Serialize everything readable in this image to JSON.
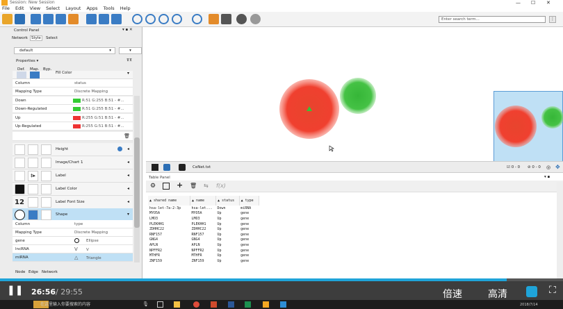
{
  "window": {
    "title": "Session: New Session"
  },
  "menu": [
    "File",
    "Edit",
    "View",
    "Select",
    "Layout",
    "Apps",
    "Tools",
    "Help"
  ],
  "search": {
    "placeholder": "Enter search term..."
  },
  "control_panel": {
    "title": "Control Panel",
    "tabs": [
      "Network",
      "Style",
      "Select"
    ],
    "style_dropdown": "default",
    "properties_label": "Properties",
    "columns": [
      "Def.",
      "Map.",
      "Byp."
    ],
    "fill_color_label": "Fill Color",
    "fill_color_mapping": [
      {
        "k": "Column",
        "v": "status"
      },
      {
        "k": "Mapping Type",
        "v": "Discrete Mapping"
      },
      {
        "k": "Down",
        "v": "R:51 G:255 B:51 - #...",
        "color": "#33cc33"
      },
      {
        "k": "Down-Regulated",
        "v": "R:51 G:255 B:51 - #...",
        "color": "#33cc33"
      },
      {
        "k": "Up",
        "v": "R:255 G:51 B:51 - #...",
        "color": "#ee3333"
      },
      {
        "k": "Up-Regulated",
        "v": "R:255 G:51 B:51 - #...",
        "color": "#ee3333"
      }
    ],
    "props": [
      "Height",
      "Image/Chart 1",
      "Label",
      "Label Color",
      "Label Font Size",
      "Shape"
    ],
    "label_font_size": "12",
    "shape_mapping": [
      {
        "k": "Column",
        "v": "type"
      },
      {
        "k": "Mapping Type",
        "v": "Discrete Mapping"
      },
      {
        "k": "gene",
        "v": "Ellipse"
      },
      {
        "k": "lncRNA",
        "v": "V"
      },
      {
        "k": "miRNA",
        "v": "Triangle"
      }
    ],
    "bottom_tabs": [
      "Node",
      "Edge",
      "Network"
    ]
  },
  "network": {
    "file": "CeNet.txt",
    "status_selected_nodes": "0 - 0",
    "status_selected_edges": "0 - 0"
  },
  "table_panel": {
    "title": "Table Panel",
    "formula": "f(x)",
    "headers": [
      "shared name",
      "name",
      "status",
      "type"
    ],
    "rows": [
      [
        "hsa-let-7a-2-3p",
        "hsa-let...",
        "Down",
        "miRNA"
      ],
      [
        "MYO5A",
        "MYO5A",
        "Up",
        "gene"
      ],
      [
        "LMO3",
        "LMO3",
        "Up",
        "gene"
      ],
      [
        "PLEKHH1",
        "PLEKHH1",
        "Up",
        "gene"
      ],
      [
        "ZDHHC22",
        "ZDHHC22",
        "Up",
        "gene"
      ],
      [
        "RNF157",
        "RNF157",
        "Up",
        "gene"
      ],
      [
        "GNG4",
        "GNG4",
        "Up",
        "gene"
      ],
      [
        "APLN",
        "APLN",
        "Up",
        "gene"
      ],
      [
        "NPFFR2",
        "NPFFR2",
        "Up",
        "gene"
      ],
      [
        "MTHFR",
        "MTHFR",
        "Up",
        "gene"
      ],
      [
        "ZNF159",
        "ZNF159",
        "Up",
        "gene"
      ]
    ]
  },
  "video": {
    "current_time": "26:56",
    "duration": "/ 29:55",
    "progress": 0.9,
    "speed_label": "倍速",
    "quality_label": "高清"
  },
  "taskbar": {
    "search_placeholder": "在这里输入你要搜索的内容",
    "date": "2018/7/14"
  },
  "colors": {
    "accent": "#1fa4d9",
    "up": "#ee3333",
    "down": "#33cc33",
    "selection": "#bfe0f5"
  }
}
